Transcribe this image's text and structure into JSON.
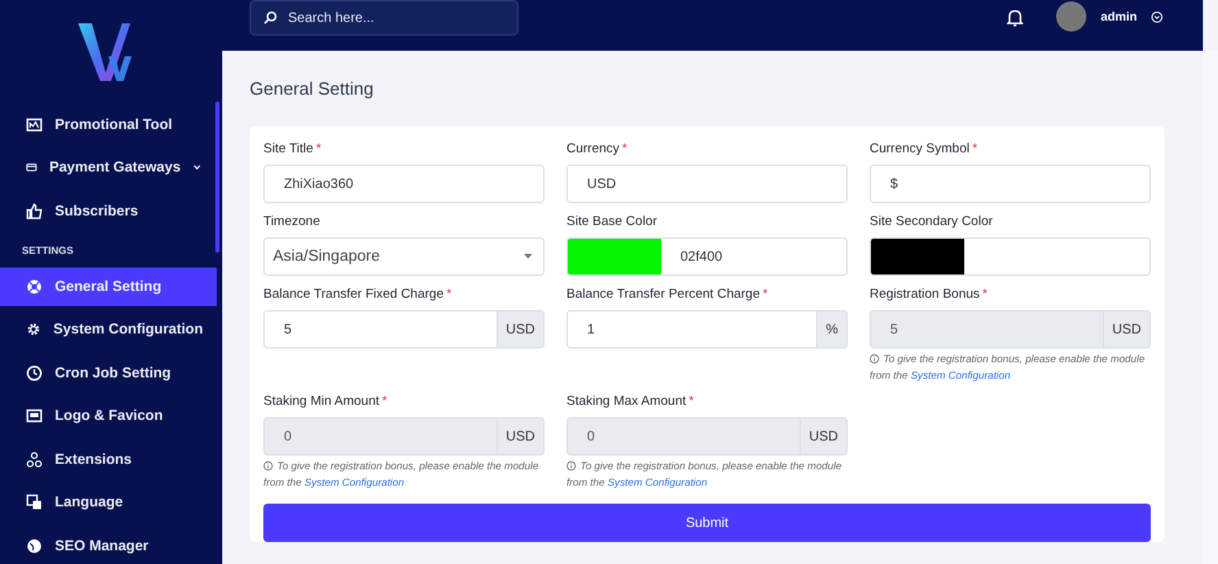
{
  "sidebar": {
    "items": [
      {
        "kind": "item",
        "label": "Promotional Tool",
        "selected": false
      },
      {
        "kind": "item",
        "label": "Payment Gateways",
        "selected": false,
        "expandable": true
      },
      {
        "kind": "item",
        "label": "Subscribers",
        "selected": false
      },
      {
        "kind": "header",
        "label": "SETTINGS"
      },
      {
        "kind": "item",
        "label": "General Setting",
        "selected": true
      },
      {
        "kind": "item",
        "label": "System Configuration",
        "selected": false
      },
      {
        "kind": "item",
        "label": "Cron Job Setting",
        "selected": false
      },
      {
        "kind": "item",
        "label": "Logo & Favicon",
        "selected": false
      },
      {
        "kind": "item",
        "label": "Extensions",
        "selected": false
      },
      {
        "kind": "item",
        "label": "Language",
        "selected": false
      },
      {
        "kind": "item",
        "label": "SEO Manager",
        "selected": false
      }
    ]
  },
  "topbar": {
    "search": {
      "placeholder": "Search here..."
    },
    "user": {
      "name": "admin"
    }
  },
  "page_title": "General Setting",
  "form": {
    "fields": [
      {
        "kind": "text",
        "label": "Site Title",
        "required_mark": "*",
        "value": "ZhiXiao360"
      },
      {
        "kind": "text",
        "label": "Currency",
        "required_mark": "*",
        "value": "USD"
      },
      {
        "kind": "text",
        "label": "Currency Symbol",
        "required_mark": "*",
        "value": "$"
      },
      {
        "kind": "select",
        "label": "Timezone",
        "value": "Asia/Singapore"
      },
      {
        "kind": "color",
        "label": "Site Base Color",
        "color": "#02f400",
        "value": "02f400"
      },
      {
        "kind": "color",
        "label": "Site Secondary Color",
        "color": "#000000"
      },
      {
        "kind": "addon",
        "label": "Balance Transfer Fixed Charge",
        "required_mark": "*",
        "value": "5",
        "addon": "USD",
        "disabled": false
      },
      {
        "kind": "addon",
        "label": "Balance Transfer Percent Charge",
        "required_mark": "*",
        "value": "1",
        "addon": "%",
        "disabled": false
      },
      {
        "kind": "addon",
        "label": "Registration Bonus",
        "required_mark": "*",
        "value": "5",
        "addon": "USD",
        "disabled": true,
        "hint": {
          "text": "To give the registration bonus, please enable the module from the ",
          "link": "System Configuration"
        }
      },
      {
        "kind": "addon",
        "label": "Staking Min Amount",
        "required_mark": "*",
        "value": "0",
        "addon": "USD",
        "disabled": true,
        "hint": {
          "text": "To give the registration bonus, please enable the module from the ",
          "link": "System Configuration"
        }
      },
      {
        "kind": "addon",
        "label": "Staking Max Amount",
        "required_mark": "*",
        "value": "0",
        "addon": "USD",
        "disabled": true,
        "hint": {
          "text": "To give the registration bonus, please enable the module from the ",
          "link": "System Configuration"
        }
      }
    ],
    "submit": "Submit"
  }
}
